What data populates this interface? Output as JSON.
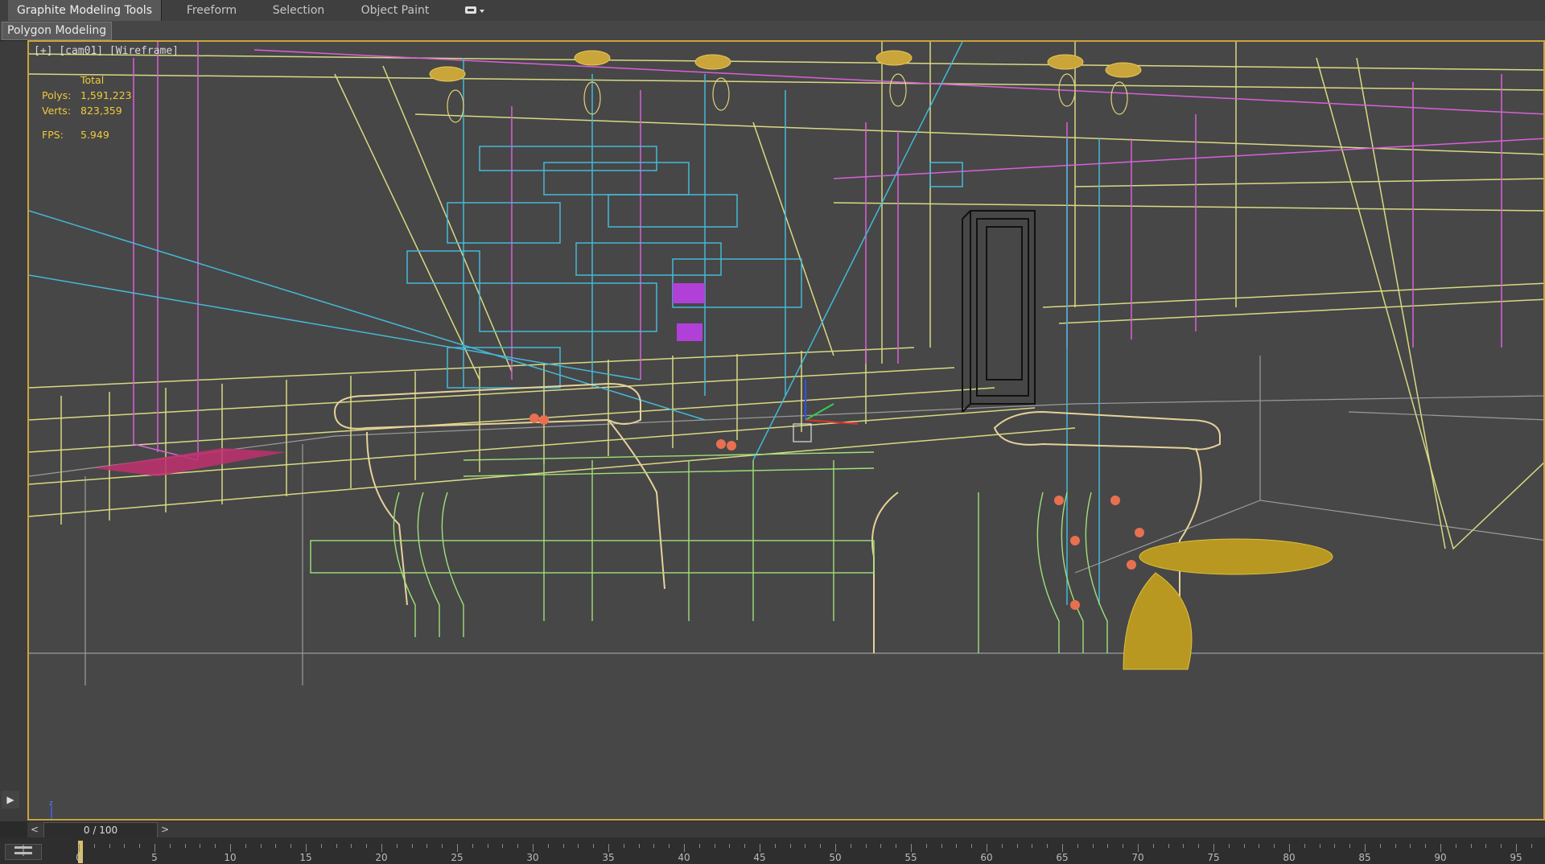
{
  "ribbon": {
    "tabs": [
      {
        "label": "Graphite Modeling Tools",
        "active": true
      },
      {
        "label": "Freeform",
        "active": false
      },
      {
        "label": "Selection",
        "active": false
      },
      {
        "label": "Object Paint",
        "active": false
      }
    ],
    "more_icon": "ribbon-options-icon",
    "panel_label": "Polygon Modeling"
  },
  "viewport": {
    "label": "[+] [cam01] [Wireframe]",
    "stats": {
      "header": "Total",
      "polys_label": "Polys:",
      "polys_value": "1,591,223",
      "verts_label": "Verts:",
      "verts_value": "823,359",
      "fps_label": "FPS:",
      "fps_value": "5.949"
    },
    "colors": {
      "background": "#474747",
      "border": "#c9a53a",
      "wire_yellow": "#e9e98a",
      "wire_cyan": "#45b8d8",
      "wire_pink": "#d860d8",
      "wire_green": "#9fe07a",
      "wire_tan": "#e6d29a"
    }
  },
  "time_slider": {
    "prev_label": "<",
    "value": "0 / 100",
    "next_label": ">"
  },
  "trackbar": {
    "ticks": [
      "0",
      "5",
      "10",
      "15",
      "20",
      "25",
      "30",
      "35",
      "40",
      "45",
      "50",
      "55",
      "60",
      "65",
      "70",
      "75",
      "80",
      "85",
      "90",
      "95"
    ],
    "current_frame": 0,
    "total_frames": 100
  }
}
